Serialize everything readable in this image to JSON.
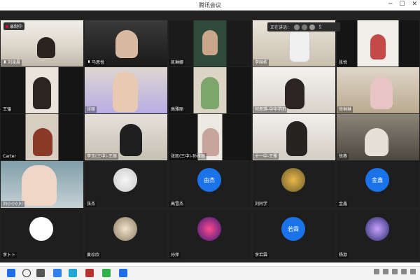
{
  "window": {
    "title": "腾讯会议"
  },
  "meeting": {
    "record_badge": "录制中",
    "top_control_text": "正在讲话：",
    "participants": [
      {
        "name": "刘凌晨"
      },
      {
        "name": "马思悦"
      },
      {
        "name": "凯琳娜"
      },
      {
        "name": "李国栋"
      },
      {
        "name": "张悦"
      },
      {
        "name": "王韫"
      },
      {
        "name": "张丽"
      },
      {
        "name": "高雅丽"
      },
      {
        "name": "何思琪-中华学团"
      },
      {
        "name": "徐琳琳"
      },
      {
        "name": "Carter"
      },
      {
        "name": "李玉(三中)-王丽"
      },
      {
        "name": "张凯(三中)-孙雅丽"
      },
      {
        "name": "十一中-王雅"
      },
      {
        "name": "徐燕"
      },
      {
        "name": "刘小小(小)"
      },
      {
        "name": "张杰"
      },
      {
        "name": "高雪杰"
      },
      {
        "name": "刘同学"
      },
      {
        "name": "金鑫"
      },
      {
        "name": "李卜卜"
      },
      {
        "name": "黄珍欣"
      },
      {
        "name": "孙萍"
      },
      {
        "name": "李若霖"
      },
      {
        "name": "杨淑"
      }
    ],
    "avatar_texts": {
      "p18": "由杰",
      "p20": "金鑫",
      "p24": "若霖"
    }
  },
  "taskbar": {
    "time": ""
  }
}
